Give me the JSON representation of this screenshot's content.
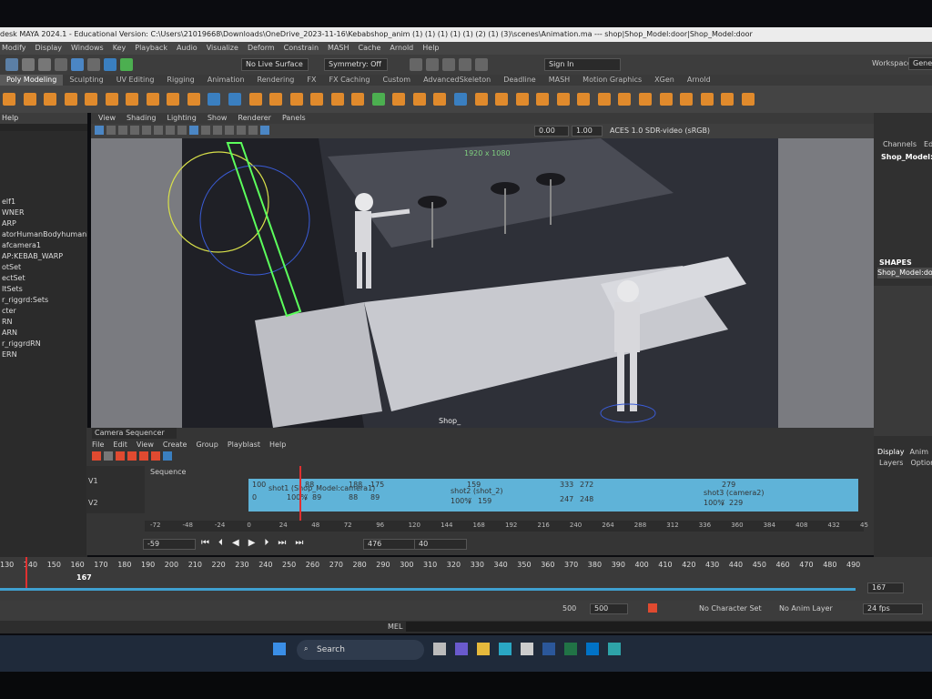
{
  "window": {
    "title": "desk MAYA 2024.1 - Educational Version: C:\\Users\\21019668\\Downloads\\OneDrive_2023-11-16\\Kebabshop_anim (1) (1) (1) (1) (1) (2) (1) (3)\\scenes\\Animation.ma  ---  shop|Shop_Model:door|Shop_Model:door"
  },
  "menubar": [
    "Modify",
    "Display",
    "Windows",
    "Key",
    "Playback",
    "Audio",
    "Visualize",
    "Deform",
    "Constrain",
    "MASH",
    "Cache",
    "Arnold",
    "Help"
  ],
  "status_line": {
    "live_surface": "No Live Surface",
    "symmetry": "Symmetry: Off",
    "sign_in": "Sign In",
    "workspace_label": "Workspace:",
    "workspace_value": "Genera"
  },
  "shelf_tabs": [
    "Poly Modeling",
    "Sculpting",
    "UV Editing",
    "Rigging",
    "Animation",
    "Rendering",
    "FX",
    "FX Caching",
    "Custom",
    "AdvancedSkeleton",
    "Deadline",
    "MASH",
    "Motion Graphics",
    "XGen",
    "Arnold"
  ],
  "left_panel": {
    "help": "Help",
    "items": [
      "elf1",
      "WNER",
      "ARP",
      "atorHumanBodyhumanBod",
      "afcamera1",
      "AP:KEBAB_WARP",
      "otSet",
      "ectSet",
      "ItSets",
      "r_riggrd:Sets",
      "cter",
      "RN",
      "ARN",
      "r_riggrdRN",
      "ERN"
    ]
  },
  "viewport": {
    "menu": [
      "View",
      "Shading",
      "Lighting",
      "Show",
      "Renderer",
      "Panels"
    ],
    "field_a": "0.00",
    "field_b": "1.00",
    "colorspace": "ACES 1.0 SDR-video (sRGB)",
    "resolution": "1920 x 1080",
    "camera_label": "Shop_"
  },
  "right_panel": {
    "tabs": [
      "Channels",
      "Edit"
    ],
    "object": "Shop_Model:door",
    "shapes_heading": "SHAPES",
    "shape": "Shop_Model:doo",
    "display_tab": "Display",
    "anim_tab": "Anim",
    "layers": "Layers",
    "options": "Options"
  },
  "sequencer": {
    "title": "Camera Sequencer",
    "menu": [
      "File",
      "Edit",
      "View",
      "Create",
      "Group",
      "Playblast",
      "Help"
    ],
    "sequence_label": "Sequence",
    "track_v1": "V1",
    "track_v2": "V2",
    "shots": [
      {
        "start": "100",
        "end": "188",
        "post": "175",
        "name": "shot1 (Shop_Model:camera1)",
        "pct": "100%",
        "slash": "/",
        "dur": "89",
        "in": "0",
        "sc_in": "88",
        "sc_out": "89"
      },
      {
        "start": "159",
        "end": "333",
        "name": "shot2 (shot_2)",
        "pct": "100%",
        "slash": "/",
        "dur": "159",
        "sc_in": "247"
      },
      {
        "start": "272",
        "end": "279",
        "name": "shot3 (camera2)",
        "pct": "100%",
        "slash": "/",
        "dur": "229",
        "sc_in": "248"
      }
    ],
    "ruler": [
      "-72",
      "-48",
      "-24",
      "0",
      "24",
      "48",
      "72",
      "96",
      "120",
      "144",
      "168",
      "192",
      "216",
      "240",
      "264",
      "288",
      "312",
      "336",
      "360",
      "384",
      "408",
      "432",
      "45"
    ],
    "current_frame": "-59",
    "field_a": "476",
    "field_b": "40"
  },
  "timeline": {
    "ticks": [
      "130",
      "140",
      "150",
      "160",
      "170",
      "180",
      "190",
      "200",
      "210",
      "220",
      "230",
      "240",
      "250",
      "260",
      "270",
      "280",
      "290",
      "300",
      "310",
      "320",
      "330",
      "340",
      "350",
      "360",
      "370",
      "380",
      "390",
      "400",
      "410",
      "420",
      "430",
      "440",
      "450",
      "460",
      "470",
      "480",
      "490"
    ],
    "current": "167",
    "current_field": "167"
  },
  "range": {
    "start": "500",
    "end": "500",
    "character_set": "No Character Set",
    "anim_layer": "No Anim Layer",
    "fps": "24 fps"
  },
  "mel_label": "MEL",
  "taskbar": {
    "search": "Search"
  },
  "colors": {
    "shot_blue": "#5fb3d8",
    "playhead_red": "#e03030",
    "timeline_blue": "#3fa0d0"
  }
}
